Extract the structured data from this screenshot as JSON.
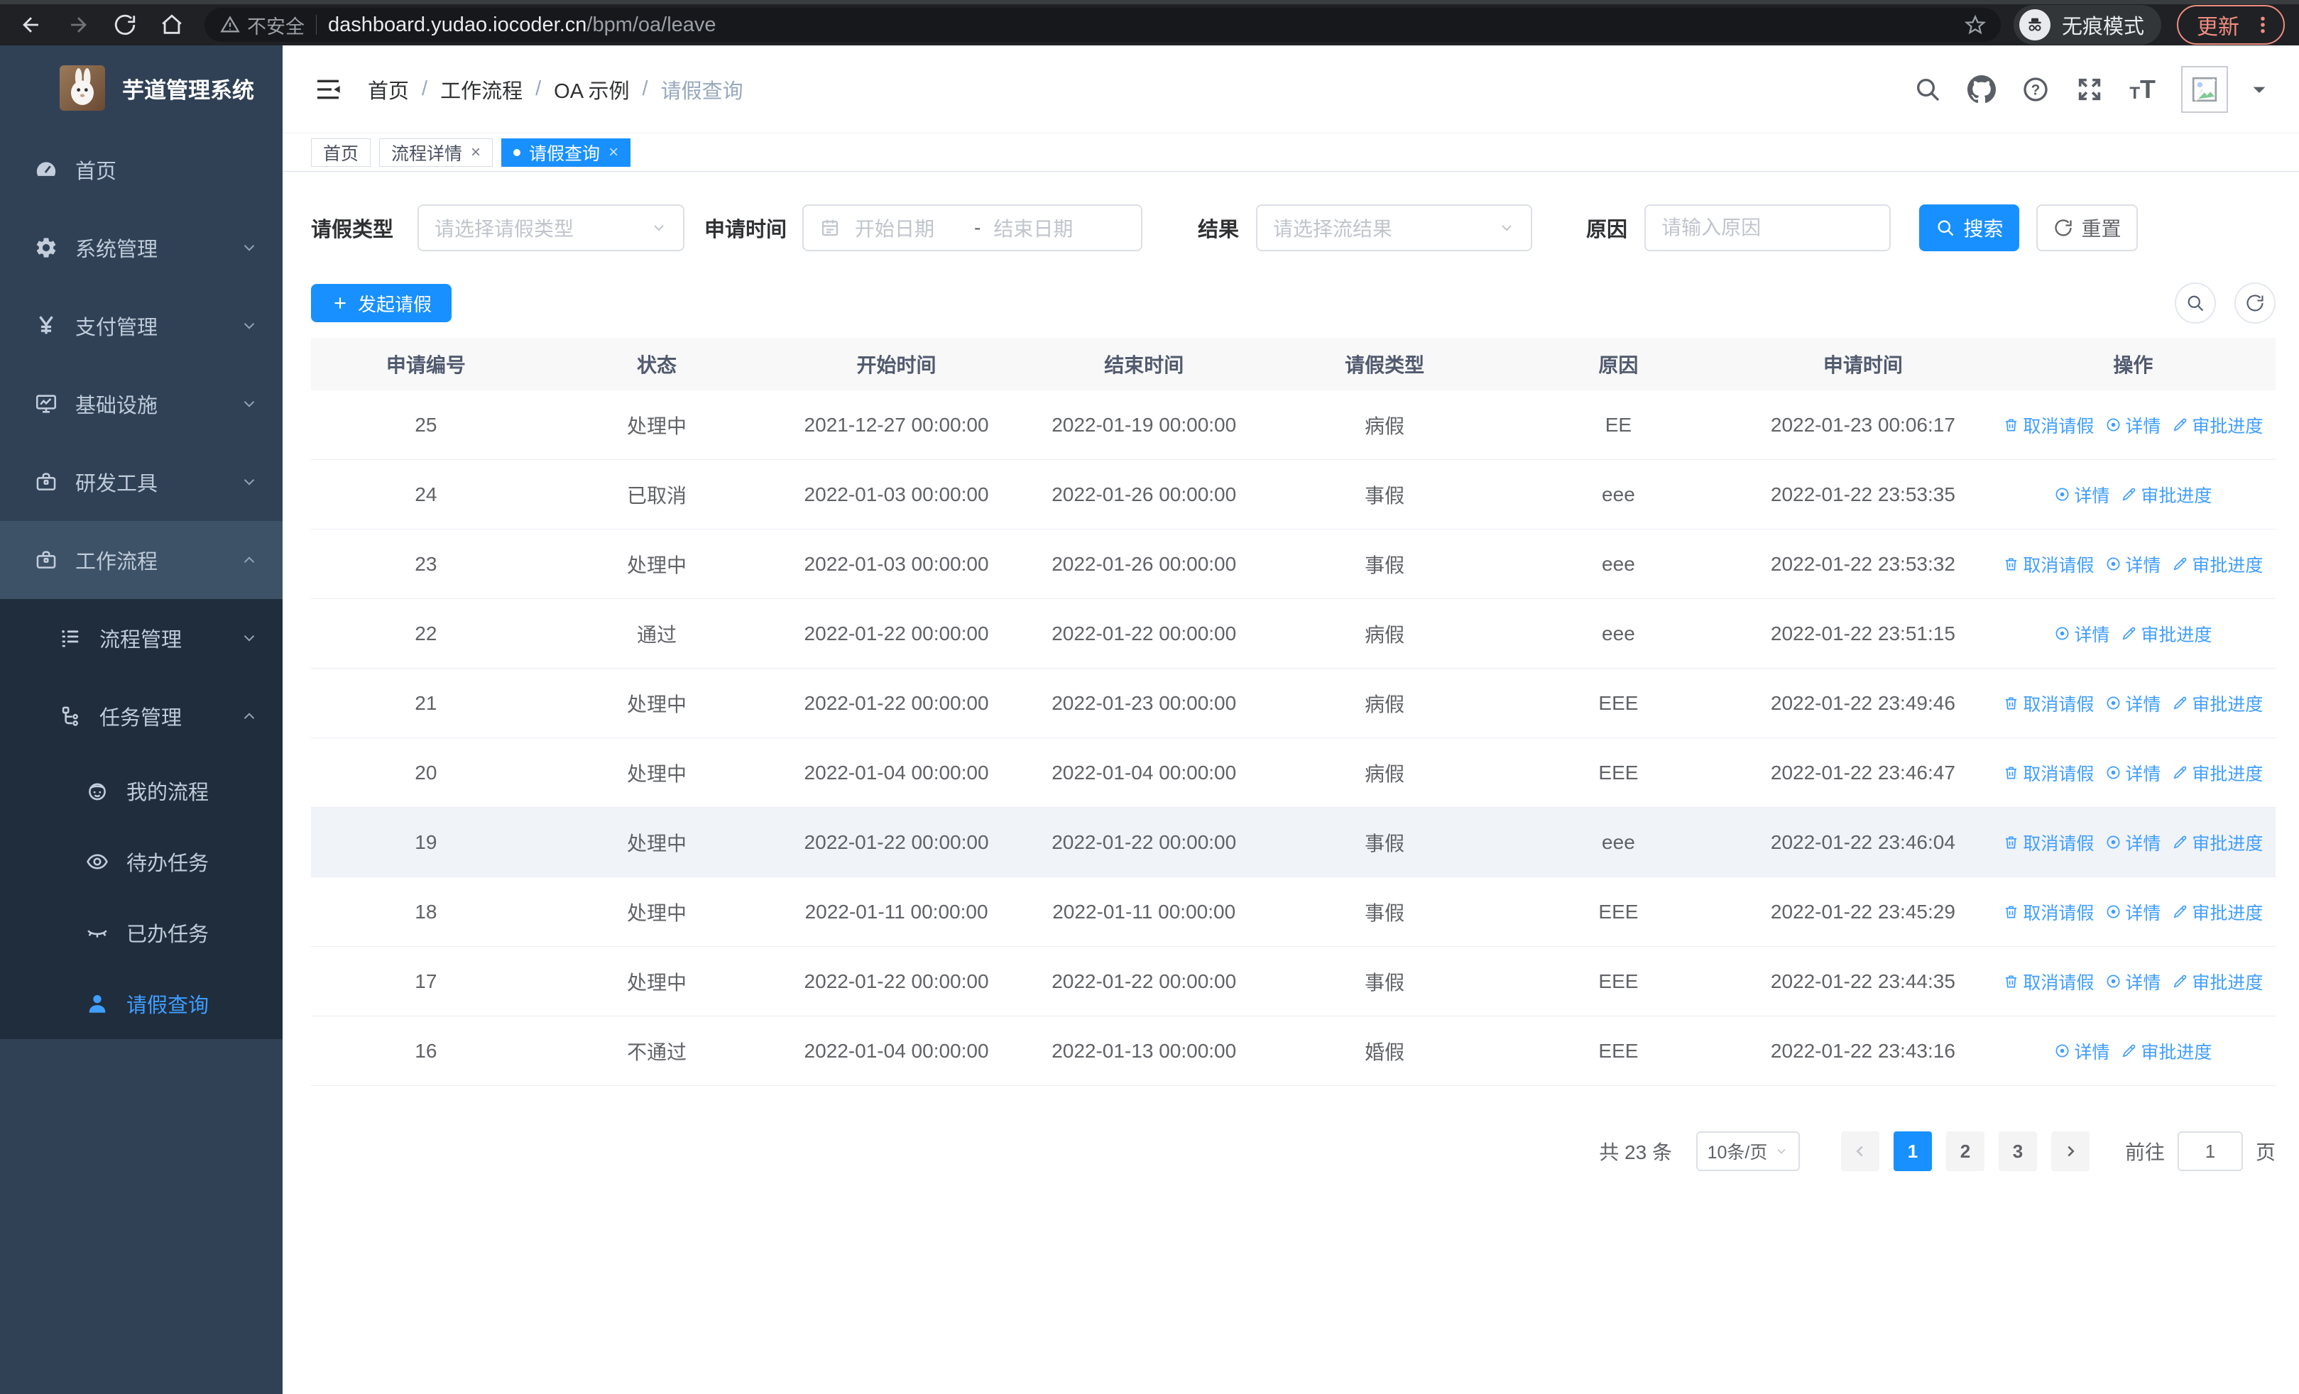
{
  "browser": {
    "security_label": "不安全",
    "url_host": "dashboard.yudao.iocoder.cn",
    "url_path": "/bpm/oa/leave",
    "incognito_label": "无痕模式",
    "update_label": "更新"
  },
  "sidebar": {
    "title": "芋道管理系统",
    "menu": [
      {
        "label": "首页",
        "icon": "dashboard-icon",
        "level": 1
      },
      {
        "label": "系统管理",
        "icon": "gear-icon",
        "level": 1,
        "chevron": "down"
      },
      {
        "label": "支付管理",
        "icon": "yen-icon",
        "level": 1,
        "chevron": "down"
      },
      {
        "label": "基础设施",
        "icon": "monitor-icon",
        "level": 1,
        "chevron": "down"
      },
      {
        "label": "研发工具",
        "icon": "toolbox-icon",
        "level": 1,
        "chevron": "down"
      },
      {
        "label": "工作流程",
        "icon": "briefcase-icon",
        "level": 1,
        "chevron": "up",
        "open": true
      },
      {
        "label": "流程管理",
        "icon": "list-icon",
        "level": 2,
        "chevron": "down",
        "group": true
      },
      {
        "label": "任务管理",
        "icon": "tree-icon",
        "level": 2,
        "chevron": "up",
        "group": true
      },
      {
        "label": "我的流程",
        "icon": "robot-icon",
        "level": 3,
        "group": true
      },
      {
        "label": "待办任务",
        "icon": "eye-icon",
        "level": 3,
        "group": true
      },
      {
        "label": "已办任务",
        "icon": "eye-closed-icon",
        "level": 3,
        "group": true
      },
      {
        "label": "请假查询",
        "icon": "user-icon",
        "level": 3,
        "group": true,
        "active": true
      }
    ]
  },
  "header": {
    "breadcrumb": [
      "首页",
      "工作流程",
      "OA 示例",
      "请假查询"
    ]
  },
  "tags": [
    {
      "label": "首页"
    },
    {
      "label": "流程详情",
      "closable": true
    },
    {
      "label": "请假查询",
      "closable": true,
      "active": true
    }
  ],
  "filters": {
    "leave_type_label": "请假类型",
    "leave_type_placeholder": "请选择请假类型",
    "apply_time_label": "申请时间",
    "start_placeholder": "开始日期",
    "range_separator": "-",
    "end_placeholder": "结束日期",
    "result_label": "结果",
    "result_placeholder": "请选择流结果",
    "reason_label": "原因",
    "reason_placeholder": "请输入原因",
    "search_label": "搜索",
    "reset_label": "重置"
  },
  "toolbar": {
    "create_label": "发起请假"
  },
  "table": {
    "columns": [
      "申请编号",
      "状态",
      "开始时间",
      "结束时间",
      "请假类型",
      "原因",
      "申请时间",
      "操作"
    ],
    "action_labels": {
      "cancel": "取消请假",
      "detail": "详情",
      "progress": "审批进度"
    },
    "rows": [
      {
        "id": "25",
        "status": "处理中",
        "start": "2021-12-27 00:00:00",
        "end": "2022-01-19 00:00:00",
        "type": "病假",
        "reason": "EE",
        "applied": "2022-01-23 00:06:17",
        "actions": [
          "cancel",
          "detail",
          "progress"
        ]
      },
      {
        "id": "24",
        "status": "已取消",
        "start": "2022-01-03 00:00:00",
        "end": "2022-01-26 00:00:00",
        "type": "事假",
        "reason": "eee",
        "applied": "2022-01-22 23:53:35",
        "actions": [
          "detail",
          "progress"
        ]
      },
      {
        "id": "23",
        "status": "处理中",
        "start": "2022-01-03 00:00:00",
        "end": "2022-01-26 00:00:00",
        "type": "事假",
        "reason": "eee",
        "applied": "2022-01-22 23:53:32",
        "actions": [
          "cancel",
          "detail",
          "progress"
        ]
      },
      {
        "id": "22",
        "status": "通过",
        "start": "2022-01-22 00:00:00",
        "end": "2022-01-22 00:00:00",
        "type": "病假",
        "reason": "eee",
        "applied": "2022-01-22 23:51:15",
        "actions": [
          "detail",
          "progress"
        ]
      },
      {
        "id": "21",
        "status": "处理中",
        "start": "2022-01-22 00:00:00",
        "end": "2022-01-23 00:00:00",
        "type": "病假",
        "reason": "EEE",
        "applied": "2022-01-22 23:49:46",
        "actions": [
          "cancel",
          "detail",
          "progress"
        ]
      },
      {
        "id": "20",
        "status": "处理中",
        "start": "2022-01-04 00:00:00",
        "end": "2022-01-04 00:00:00",
        "type": "病假",
        "reason": "EEE",
        "applied": "2022-01-22 23:46:47",
        "actions": [
          "cancel",
          "detail",
          "progress"
        ]
      },
      {
        "id": "19",
        "status": "处理中",
        "start": "2022-01-22 00:00:00",
        "end": "2022-01-22 00:00:00",
        "type": "事假",
        "reason": "eee",
        "applied": "2022-01-22 23:46:04",
        "actions": [
          "cancel",
          "detail",
          "progress"
        ],
        "highlighted": true
      },
      {
        "id": "18",
        "status": "处理中",
        "start": "2022-01-11 00:00:00",
        "end": "2022-01-11 00:00:00",
        "type": "事假",
        "reason": "EEE",
        "applied": "2022-01-22 23:45:29",
        "actions": [
          "cancel",
          "detail",
          "progress"
        ]
      },
      {
        "id": "17",
        "status": "处理中",
        "start": "2022-01-22 00:00:00",
        "end": "2022-01-22 00:00:00",
        "type": "事假",
        "reason": "EEE",
        "applied": "2022-01-22 23:44:35",
        "actions": [
          "cancel",
          "detail",
          "progress"
        ]
      },
      {
        "id": "16",
        "status": "不通过",
        "start": "2022-01-04 00:00:00",
        "end": "2022-01-13 00:00:00",
        "type": "婚假",
        "reason": "EEE",
        "applied": "2022-01-22 23:43:16",
        "actions": [
          "detail",
          "progress"
        ]
      }
    ]
  },
  "pagination": {
    "total_label": "共 23 条",
    "page_size": "10条/页",
    "pages": [
      "1",
      "2",
      "3"
    ],
    "active_page": "1",
    "goto_label": "前往",
    "goto_value": "1",
    "page_unit": "页"
  },
  "colors": {
    "primary": "#1890ff",
    "link": "#409eff",
    "sidebar_bg": "#304156",
    "submenu_bg": "#1f2d3d",
    "update_accent": "#ef8d80"
  }
}
